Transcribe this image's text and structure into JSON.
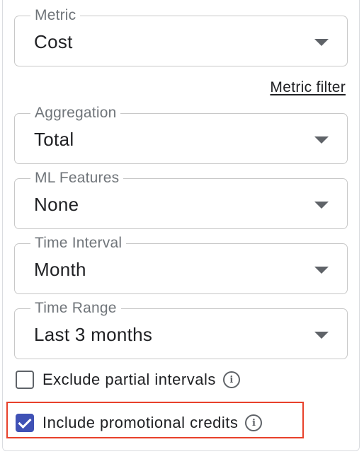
{
  "fields": [
    {
      "label": "Metric",
      "value": "Cost"
    },
    {
      "label": "Aggregation",
      "value": "Total"
    },
    {
      "label": "ML Features",
      "value": "None"
    },
    {
      "label": "Time Interval",
      "value": "Month"
    },
    {
      "label": "Time Range",
      "value": "Last 3 months"
    }
  ],
  "metric_filter_link": "Metric filter",
  "checkboxes": [
    {
      "label": "Exclude partial intervals",
      "checked": false
    },
    {
      "label": "Include promotional credits",
      "checked": true
    }
  ],
  "colors": {
    "checkbox_accent": "#3f51b5",
    "highlight": "#e8412b",
    "caret": "#5f6368"
  },
  "icons": {
    "info": "info-circle-icon",
    "dropdown": "caret-down-icon"
  }
}
